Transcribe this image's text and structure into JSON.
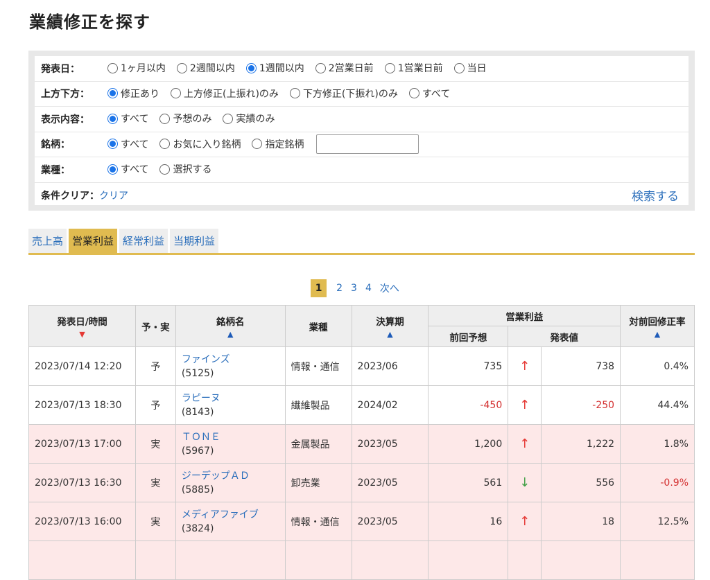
{
  "page": {
    "title": "業績修正を探す"
  },
  "filters": {
    "announce_date": {
      "label": "発表日：",
      "options": [
        "1ヶ月以内",
        "2週間以内",
        "1週間以内",
        "2営業日前",
        "1営業日前",
        "当日"
      ],
      "selected": "1週間以内"
    },
    "direction": {
      "label": "上方下方：",
      "options": [
        "修正あり",
        "上方修正(上振れ)のみ",
        "下方修正(下振れ)のみ",
        "すべて"
      ],
      "selected": "修正あり"
    },
    "display": {
      "label": "表示内容：",
      "options": [
        "すべて",
        "予想のみ",
        "実績のみ"
      ],
      "selected": "すべて"
    },
    "stock": {
      "label": "銘柄：",
      "options": [
        "すべて",
        "お気に入り銘柄",
        "指定銘柄"
      ],
      "selected": "すべて",
      "input_value": ""
    },
    "industry": {
      "label": "業種：",
      "options": [
        "すべて",
        "選択する"
      ],
      "selected": "すべて"
    },
    "clear_label": "条件クリア：",
    "clear_link": "クリア",
    "search_link": "検索する"
  },
  "tabs": [
    {
      "label": "売上高",
      "active": false
    },
    {
      "label": "営業利益",
      "active": true
    },
    {
      "label": "経常利益",
      "active": false
    },
    {
      "label": "当期利益",
      "active": false
    }
  ],
  "pagination": {
    "pages": [
      "1",
      "2",
      "3",
      "4"
    ],
    "current": "1",
    "next": "次へ"
  },
  "table": {
    "headers": {
      "date": "発表日/時間",
      "type": "予・実",
      "name": "銘柄名",
      "industry": "業種",
      "period": "決算期",
      "op_profit": "営業利益",
      "prev_forecast": "前回予想",
      "announced": "発表値",
      "rate": "対前回修正率"
    },
    "sort_indicators": {
      "date": "▼",
      "name": "▲",
      "period": "▲",
      "rate": "▲"
    },
    "rows": [
      {
        "date": "2023/07/14 12:20",
        "type": "予",
        "name": "ファインズ",
        "code": "(5125)",
        "industry": "情報・通信",
        "period": "2023/06",
        "prev": "735",
        "arrow": "↑",
        "direction": "up",
        "value": "738",
        "rate": "0.4%",
        "actual": false
      },
      {
        "date": "2023/07/13 18:30",
        "type": "予",
        "name": "ラピーヌ",
        "code": "(8143)",
        "industry": "繊維製品",
        "period": "2024/02",
        "prev": "-450",
        "arrow": "↑",
        "direction": "up",
        "value": "-250",
        "rate": "44.4%",
        "actual": false
      },
      {
        "date": "2023/07/13 17:00",
        "type": "実",
        "name": "ＴＯＮＥ",
        "code": "(5967)",
        "industry": "金属製品",
        "period": "2023/05",
        "prev": "1,200",
        "arrow": "↑",
        "direction": "up",
        "value": "1,222",
        "rate": "1.8%",
        "actual": true
      },
      {
        "date": "2023/07/13 16:30",
        "type": "実",
        "name": "ジーデップＡＤ",
        "code": "(5885)",
        "industry": "卸売業",
        "period": "2023/05",
        "prev": "561",
        "arrow": "↓",
        "direction": "down",
        "value": "556",
        "rate": "-0.9%",
        "actual": true
      },
      {
        "date": "2023/07/13 16:00",
        "type": "実",
        "name": "メディアファイブ",
        "code": "(3824)",
        "industry": "情報・通信",
        "period": "2023/05",
        "prev": "16",
        "arrow": "↑",
        "direction": "up",
        "value": "18",
        "rate": "12.5%",
        "actual": true
      },
      {
        "date": "",
        "type": "",
        "name": "",
        "code": "",
        "industry": "",
        "period": "",
        "prev": "",
        "arrow": "",
        "direction": "",
        "value": "",
        "rate": "",
        "actual": true
      }
    ]
  }
}
